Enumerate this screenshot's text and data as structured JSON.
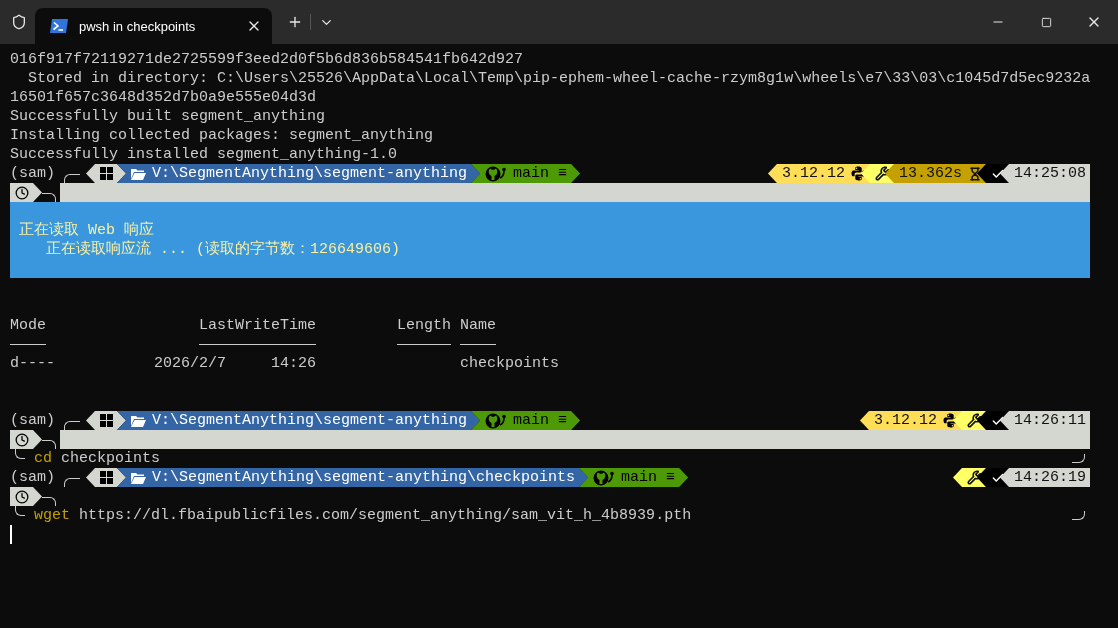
{
  "window": {
    "tab_title": "pwsh in checkpoints"
  },
  "terminal": [
    {
      "kind": "text",
      "text": "016f917f72119271de2725599f3eed2d0f5b6d836b584541fb642d927"
    },
    {
      "kind": "text",
      "text": "  Stored in directory: C:\\Users\\25526\\AppData\\Local\\Temp\\pip-ephem-wheel-cache-rzym8g1w\\wheels\\e7\\33\\03\\c1045d7d5ec9232a"
    },
    {
      "kind": "text",
      "text": "16501f657c3648d352d7b0a9e555e04d3d"
    },
    {
      "kind": "text",
      "text": "Successfully built segment_anything"
    },
    {
      "kind": "text",
      "text": "Installing collected packages: segment_anything"
    },
    {
      "kind": "text",
      "text": "Successfully installed segment_anything-1.0"
    },
    {
      "kind": "prompt",
      "env": "(sam)",
      "path": "V:\\SegmentAnything\\segment-anything",
      "branch": "main ≡",
      "filler_bar": true,
      "right": [
        {
          "kind": "python",
          "text": "3.12.12"
        },
        {
          "kind": "tool"
        },
        {
          "kind": "duration",
          "text": "13.362s"
        },
        {
          "kind": "status",
          "ok": true
        },
        {
          "kind": "time",
          "text": "14:25:08"
        }
      ]
    },
    {
      "kind": "progress",
      "lines": [
        "正在读取 Web 响应",
        "   正在读取响应流 ... (读取的字节数：126649606)"
      ]
    },
    {
      "kind": "blank"
    },
    {
      "kind": "blank"
    },
    {
      "kind": "listing",
      "columns": [
        "Mode",
        "LastWriteTime",
        "Length",
        "Name"
      ],
      "rows": [
        {
          "mode": "d----",
          "date": "2026/2/7",
          "time": "14:26",
          "name": "checkpoints"
        }
      ]
    },
    {
      "kind": "blank"
    },
    {
      "kind": "blank"
    },
    {
      "kind": "prompt",
      "env": "(sam)",
      "path": "V:\\SegmentAnything\\segment-anything",
      "branch": "main ≡",
      "filler_bar": true,
      "right": [
        {
          "kind": "python",
          "text": "3.12.12"
        },
        {
          "kind": "tool"
        },
        {
          "kind": "status",
          "ok": true
        },
        {
          "kind": "time",
          "text": "14:26:11"
        }
      ],
      "command": {
        "verb": "cd",
        "args": "checkpoints"
      }
    },
    {
      "kind": "prompt",
      "env": "(sam)",
      "path": "V:\\SegmentAnything\\segment-anything\\checkpoints",
      "branch": "main ≡",
      "filler_bar": false,
      "right": [
        {
          "kind": "tool"
        },
        {
          "kind": "status",
          "ok": true
        },
        {
          "kind": "time",
          "text": "14:26:19"
        }
      ],
      "command": {
        "verb": "wget",
        "args": "https://dl.fbaipublicfiles.com/segment_anything/sam_vit_h_4b8939.pth"
      }
    },
    {
      "kind": "cursor"
    }
  ]
}
